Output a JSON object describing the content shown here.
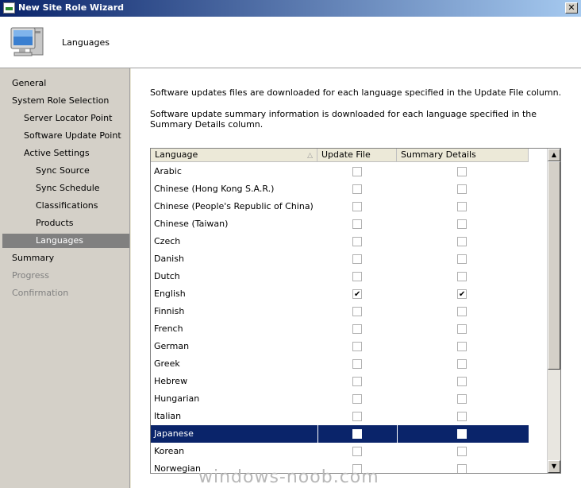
{
  "window": {
    "title": "New Site Role Wizard",
    "close_glyph": "✕"
  },
  "header": {
    "page_title": "Languages",
    "icon": "computer-monitor-icon"
  },
  "nav": {
    "items": [
      {
        "label": "General",
        "level": 0,
        "state": "normal"
      },
      {
        "label": "System Role Selection",
        "level": 0,
        "state": "normal"
      },
      {
        "label": "Server Locator Point",
        "level": 1,
        "state": "normal"
      },
      {
        "label": "Software Update Point",
        "level": 1,
        "state": "normal"
      },
      {
        "label": "Active Settings",
        "level": 1,
        "state": "normal"
      },
      {
        "label": "Sync Source",
        "level": 2,
        "state": "normal"
      },
      {
        "label": "Sync Schedule",
        "level": 2,
        "state": "normal"
      },
      {
        "label": "Classifications",
        "level": 2,
        "state": "normal"
      },
      {
        "label": "Products",
        "level": 2,
        "state": "normal"
      },
      {
        "label": "Languages",
        "level": 2,
        "state": "selected"
      },
      {
        "label": "Summary",
        "level": 0,
        "state": "normal"
      },
      {
        "label": "Progress",
        "level": 0,
        "state": "disabled"
      },
      {
        "label": "Confirmation",
        "level": 0,
        "state": "disabled"
      }
    ]
  },
  "content": {
    "desc1": "Software updates files are downloaded for each language specified in the Update File column.",
    "desc2": "Software update summary information is downloaded for each language specified in the Summary Details column.",
    "columns": {
      "language": "Language",
      "update_file": "Update File",
      "summary_details": "Summary Details",
      "sort_glyph": "△"
    },
    "languages": [
      {
        "name": "Arabic",
        "update_file": false,
        "summary_details": false,
        "selected": false
      },
      {
        "name": "Chinese (Hong Kong S.A.R.)",
        "update_file": false,
        "summary_details": false,
        "selected": false
      },
      {
        "name": "Chinese (People's Republic of China)",
        "update_file": false,
        "summary_details": false,
        "selected": false
      },
      {
        "name": "Chinese (Taiwan)",
        "update_file": false,
        "summary_details": false,
        "selected": false
      },
      {
        "name": "Czech",
        "update_file": false,
        "summary_details": false,
        "selected": false
      },
      {
        "name": "Danish",
        "update_file": false,
        "summary_details": false,
        "selected": false
      },
      {
        "name": "Dutch",
        "update_file": false,
        "summary_details": false,
        "selected": false
      },
      {
        "name": "English",
        "update_file": true,
        "summary_details": true,
        "selected": false
      },
      {
        "name": "Finnish",
        "update_file": false,
        "summary_details": false,
        "selected": false
      },
      {
        "name": "French",
        "update_file": false,
        "summary_details": false,
        "selected": false
      },
      {
        "name": "German",
        "update_file": false,
        "summary_details": false,
        "selected": false
      },
      {
        "name": "Greek",
        "update_file": false,
        "summary_details": false,
        "selected": false
      },
      {
        "name": "Hebrew",
        "update_file": false,
        "summary_details": false,
        "selected": false
      },
      {
        "name": "Hungarian",
        "update_file": false,
        "summary_details": false,
        "selected": false
      },
      {
        "name": "Italian",
        "update_file": false,
        "summary_details": false,
        "selected": false
      },
      {
        "name": "Japanese",
        "update_file": false,
        "summary_details": false,
        "selected": true
      },
      {
        "name": "Korean",
        "update_file": false,
        "summary_details": false,
        "selected": false
      },
      {
        "name": "Norwegian",
        "update_file": false,
        "summary_details": false,
        "selected": false
      }
    ],
    "scroll": {
      "up_glyph": "▲",
      "down_glyph": "▼"
    }
  },
  "watermark": "windows-noob.com",
  "colors": {
    "title_bar": "#0a246a",
    "selection": "#0a246a",
    "nav_selected": "#808080"
  }
}
